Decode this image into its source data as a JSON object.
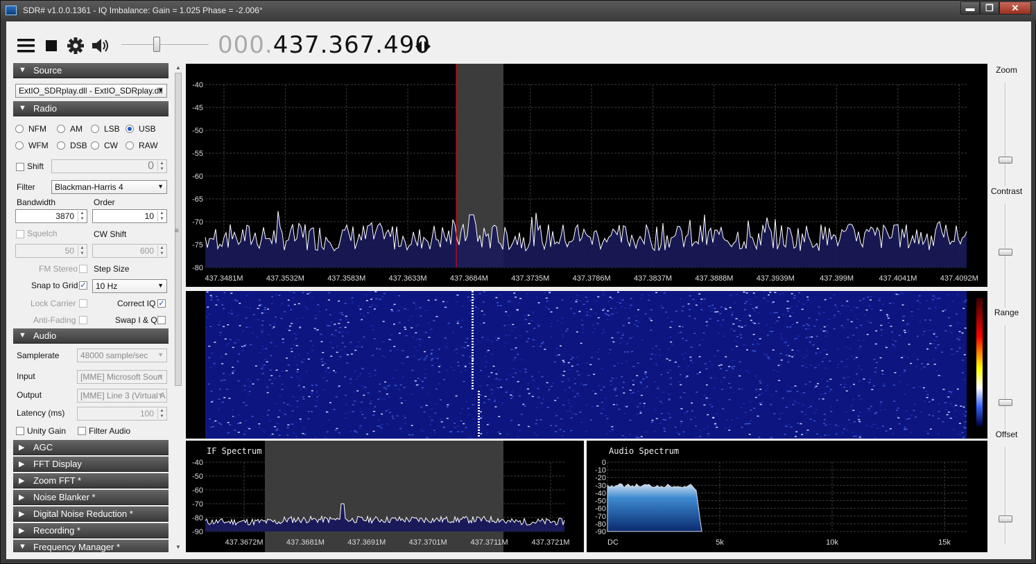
{
  "window": {
    "title": "SDR# v1.0.0.1361 - IQ Imbalance: Gain = 1.025 Phase = -2.006°",
    "minimize": "▬",
    "maximize": "❐",
    "close": "✕"
  },
  "toolbar": {
    "menu_icon": "hamburger-icon",
    "stop_icon": "stop-icon",
    "settings_icon": "gear-icon",
    "volume_icon": "speaker-icon",
    "volume_level": 0.4,
    "freq_prefix": "000.",
    "freq_main": "437.367.490",
    "tune_icon": "arrow-left-right-icon"
  },
  "source": {
    "header": "Source",
    "device": "ExtIO_SDRplay.dll - ExtIO_SDRplay.dll"
  },
  "radio": {
    "header": "Radio",
    "modes": [
      {
        "label": "NFM",
        "selected": false
      },
      {
        "label": "AM",
        "selected": false
      },
      {
        "label": "LSB",
        "selected": false
      },
      {
        "label": "USB",
        "selected": true
      },
      {
        "label": "WFM",
        "selected": false
      },
      {
        "label": "DSB",
        "selected": false
      },
      {
        "label": "CW",
        "selected": false
      },
      {
        "label": "RAW",
        "selected": false
      }
    ],
    "shift_label": "Shift",
    "shift_value": "0",
    "filter_label": "Filter",
    "filter_value": "Blackman-Harris 4",
    "bandwidth_label": "Bandwidth",
    "bandwidth_value": "3870",
    "order_label": "Order",
    "order_value": "10",
    "squelch_label": "Squelch",
    "squelch_value": "50",
    "cwshift_label": "CW Shift",
    "cwshift_value": "600",
    "fmstereo_label": "FM Stereo",
    "stepsize_label": "Step Size",
    "snap_label": "Snap to Grid",
    "step_value": "10 Hz",
    "lock_label": "Lock Carrier",
    "correctiq_label": "Correct IQ",
    "antifading_label": "Anti-Fading",
    "swapiq_label": "Swap I & Q"
  },
  "audio": {
    "header": "Audio",
    "samplerate_label": "Samplerate",
    "samplerate_value": "48000 sample/sec",
    "input_label": "Input",
    "input_value": "[MME] Microsoft Soun",
    "output_label": "Output",
    "output_value": "[MME] Line 3 (Virtual A",
    "latency_label": "Latency (ms)",
    "latency_value": "100",
    "unity_label": "Unity Gain",
    "filteraudio_label": "Filter Audio"
  },
  "collapsed_sections": [
    "AGC",
    "FFT Display",
    "Zoom FFT *",
    "Noise Blanker *",
    "Digital Noise Reduction *",
    "Recording *"
  ],
  "freqmgr_header": "Frequency Manager *",
  "main_spectrum": {
    "y_ticks": [
      "-40",
      "-45",
      "-50",
      "-55",
      "-60",
      "-65",
      "-70",
      "-75",
      "-80"
    ],
    "x_ticks": [
      "437.3481M",
      "437.3532M",
      "437.3583M",
      "437.3633M",
      "437.3684M",
      "437.3735M",
      "437.3786M",
      "437.3837M",
      "437.3888M",
      "437.3939M",
      "437.399M",
      "437.4041M",
      "437.4092M"
    ],
    "colors": {
      "trace": "#ffffff",
      "fill": "#1a1a5a",
      "grid": "#3a3a3a",
      "cursor": "#ff0000",
      "passband": "#3c3c3c"
    }
  },
  "if_spectrum": {
    "title": "IF Spectrum",
    "y_ticks": [
      "-40",
      "-50",
      "-60",
      "-70",
      "-80",
      "-90"
    ],
    "x_ticks": [
      "437.3672M",
      "437.3681M",
      "437.3691M",
      "437.3701M",
      "437.3711M",
      "437.3721M"
    ]
  },
  "audio_spectrum": {
    "title": "Audio Spectrum",
    "y_ticks": [
      "0",
      "-10",
      "-20",
      "-30",
      "-40",
      "-50",
      "-60",
      "-70",
      "-80",
      "-90"
    ],
    "x_ticks": [
      "DC",
      "5k",
      "10k",
      "15k"
    ]
  },
  "right_panel": {
    "zoom_label": "Zoom",
    "zoom_level": 0.2,
    "contrast_label": "Contrast",
    "contrast_level": 0.5,
    "range_label": "Range",
    "range_level": 0.2,
    "offset_label": "Offset",
    "offset_level": 0.2
  }
}
